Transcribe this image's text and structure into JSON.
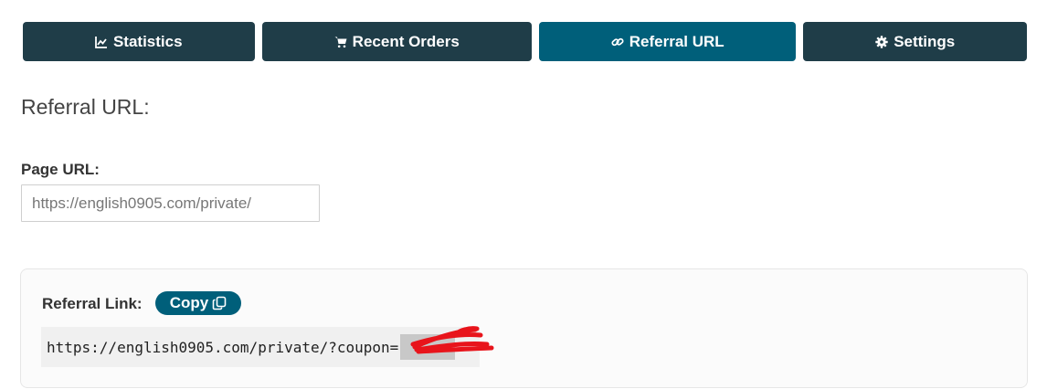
{
  "tabs": [
    {
      "label": "Statistics",
      "icon": "chart-line-icon",
      "active": false
    },
    {
      "label": "Recent Orders",
      "icon": "cart-icon",
      "active": false
    },
    {
      "label": "Referral URL",
      "icon": "link-icon",
      "active": true
    },
    {
      "label": "Settings",
      "icon": "gear-icon",
      "active": false
    }
  ],
  "heading": "Referral URL:",
  "page_url": {
    "label": "Page URL:",
    "value": "",
    "placeholder": "https://english0905.com/private/"
  },
  "referral": {
    "label": "Referral Link:",
    "copy_label": "Copy",
    "link": "https://english0905.com/private/?coupon="
  },
  "colors": {
    "tab_bg": "#1f3d48",
    "tab_active_bg": "#005f7a",
    "copy_bg": "#005f7a",
    "redaction": "#e8141b"
  }
}
